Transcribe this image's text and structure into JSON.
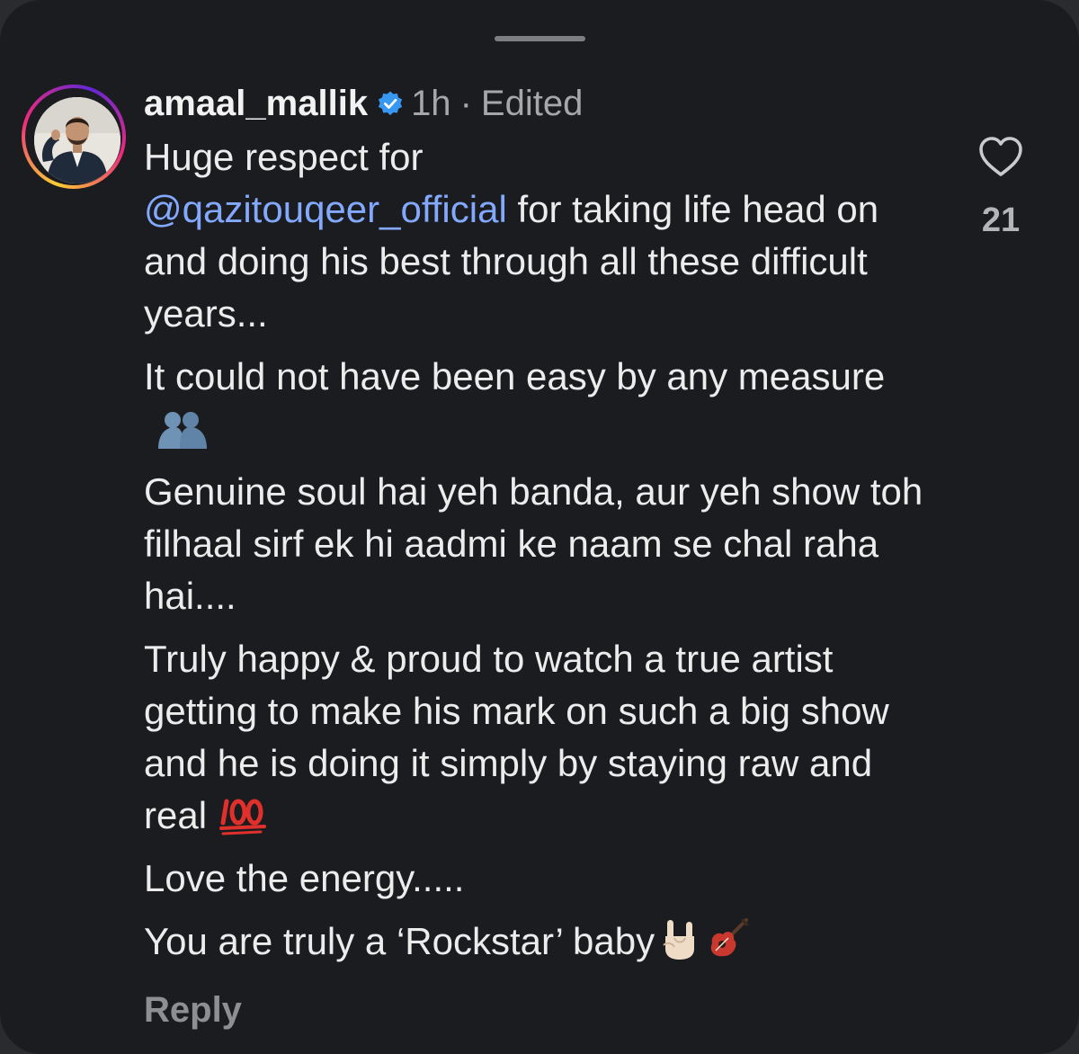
{
  "comment": {
    "username": "amaal_mallik",
    "verified": true,
    "time": "1h",
    "separator": "·",
    "edited": "Edited",
    "mention": "@qazitouqeer_official",
    "lines": {
      "p1_start": "Huge respect for",
      "p1_after_mention": "for taking life head on and doing his best through all these difficult years...",
      "p2": "It could not have been easy by any measure",
      "p3": "Genuine soul hai yeh banda, aur yeh show toh filhaal sirf ek hi aadmi ke naam se chal raha hai....",
      "p4": "Truly happy & proud to watch a true artist getting to make his mark on such a big show and he is doing it simply by staying raw and real",
      "p5": "Love the energy.....",
      "p6": "You are truly a ‘Rockstar’ baby"
    },
    "emojis": {
      "p2": "hugging-people-emoji",
      "p4": "hundred-points-emoji",
      "p6_first": "rock-on-hand-emoji",
      "p6_second": "guitar-emoji"
    },
    "reply_label": "Reply",
    "like_count": "21"
  },
  "colors": {
    "background": "#1b1c1f",
    "text": "#ececec",
    "secondary_text": "#a6a7aa",
    "mention": "#83a9ff",
    "verified": "#3897f0"
  }
}
